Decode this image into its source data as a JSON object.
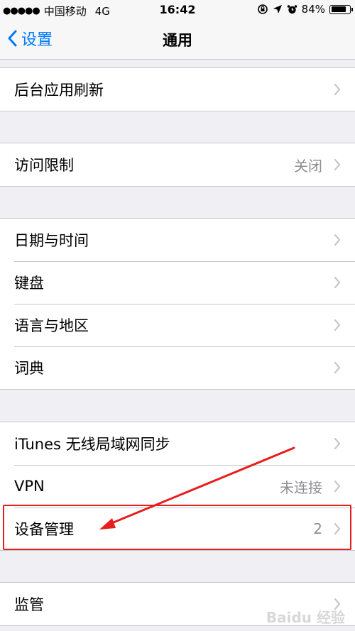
{
  "status_bar": {
    "signal_dots": "●●●●●",
    "carrier": "中国移动",
    "network": "4G",
    "time": "16:42",
    "battery_percent_text": "84%",
    "battery_level": 0.84
  },
  "nav": {
    "back_label": "设置",
    "title": "通用"
  },
  "groups": [
    {
      "rows": [
        {
          "label": "后台应用刷新",
          "value": ""
        }
      ]
    },
    {
      "rows": [
        {
          "label": "访问限制",
          "value": "关闭"
        }
      ]
    },
    {
      "rows": [
        {
          "label": "日期与时间",
          "value": ""
        },
        {
          "label": "键盘",
          "value": ""
        },
        {
          "label": "语言与地区",
          "value": ""
        },
        {
          "label": "词典",
          "value": ""
        }
      ]
    },
    {
      "rows": [
        {
          "label": "iTunes 无线局域网同步",
          "value": ""
        },
        {
          "label": "VPN",
          "value": "未连接"
        },
        {
          "label": "设备管理",
          "value": "2"
        }
      ]
    },
    {
      "rows": [
        {
          "label": "监管",
          "value": ""
        }
      ]
    }
  ],
  "annotation": {
    "highlight_color": "#e81d1d",
    "target": "设备管理"
  },
  "watermark": "Baidu 经验",
  "colors": {
    "accent": "#007aff",
    "background": "#efeff4",
    "secondary_text": "#8e8e93"
  }
}
